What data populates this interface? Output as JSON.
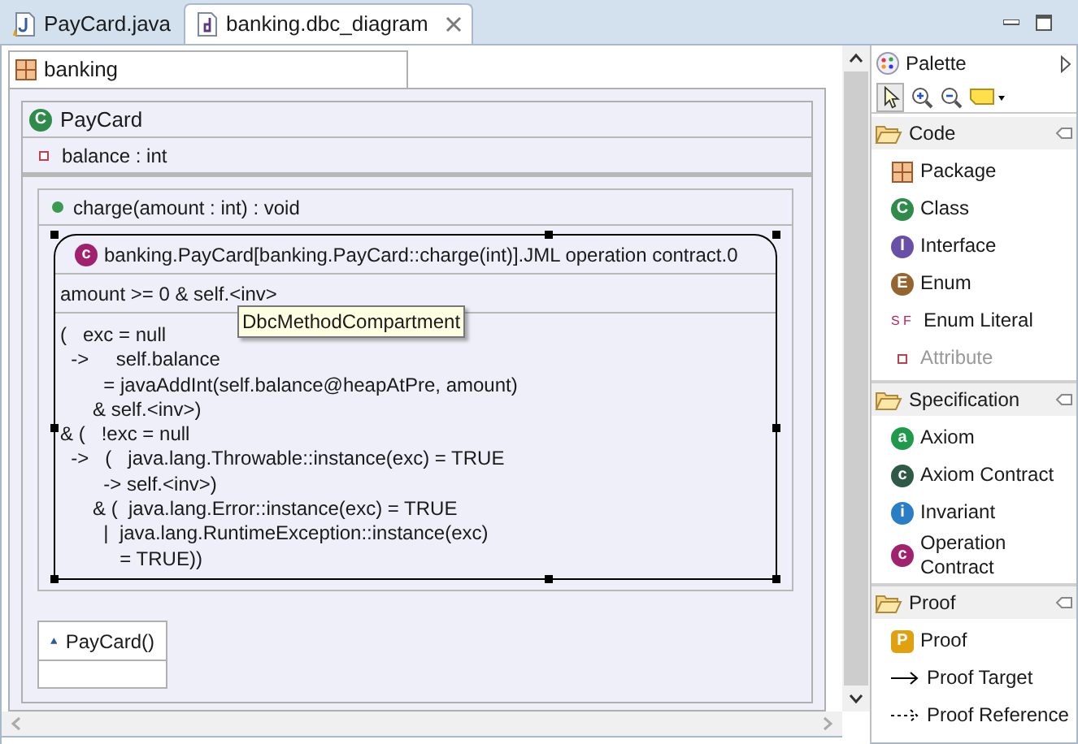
{
  "tabs": [
    {
      "label": "PayCard.java",
      "selected": false,
      "kind": "java"
    },
    {
      "label": "banking.dbc_diagram",
      "selected": true,
      "kind": "diagram"
    }
  ],
  "diagram": {
    "package": {
      "name": "banking"
    },
    "class": {
      "badge": "C",
      "name": "PayCard",
      "attributes": [
        "balance : int"
      ],
      "operation": {
        "signature": "charge(amount : int) : void",
        "selected": true,
        "contract": {
          "badge": "c",
          "title": "banking.PayCard[banking.PayCard::charge(int)].JML operation contract.0",
          "precondition": "amount >= 0 & self.<inv>",
          "postcondition": [
            "(   exc = null",
            "  ->     self.balance",
            "        = javaAddInt(self.balance@heapAtPre, amount)",
            "      & self.<inv>)",
            "& (   !exc = null",
            "  ->   (   java.lang.Throwable::instance(exc) = TRUE",
            "        -> self.<inv>)",
            "      & (  java.lang.Error::instance(exc) = TRUE",
            "        |  java.lang.RuntimeException::instance(exc)",
            "           = TRUE))"
          ]
        }
      },
      "constructor": "PayCard()"
    },
    "tooltip": "DbcMethodCompartment"
  },
  "palette": {
    "title": "Palette",
    "groups": [
      {
        "label": "Code",
        "expanded": true,
        "items": [
          {
            "label": "Package",
            "kind": "package",
            "disabled": false
          },
          {
            "label": "Class",
            "kind": "badge",
            "badge": "C",
            "color": "#2e8b4a",
            "disabled": false
          },
          {
            "label": "Interface",
            "kind": "badge",
            "badge": "I",
            "color": "#6a4fa8",
            "disabled": false
          },
          {
            "label": "Enum",
            "kind": "badge",
            "badge": "E",
            "color": "#94652f",
            "disabled": false
          },
          {
            "label": "Enum Literal",
            "kind": "literal",
            "badge": "S F",
            "disabled": false
          },
          {
            "label": "Attribute",
            "kind": "attribute",
            "disabled": true
          }
        ]
      },
      {
        "label": "Specification",
        "expanded": true,
        "items": [
          {
            "label": "Axiom",
            "kind": "badge",
            "badge": "a",
            "color": "#1f9a4a",
            "disabled": false
          },
          {
            "label": "Axiom Contract",
            "kind": "badge",
            "badge": "c",
            "color": "#2f5a46",
            "disabled": false
          },
          {
            "label": "Invariant",
            "kind": "badge",
            "badge": "i",
            "color": "#2a7fc4",
            "disabled": false
          },
          {
            "label": "Operation Contract",
            "kind": "badge",
            "badge": "c",
            "color": "#a0226e",
            "disabled": false
          }
        ]
      },
      {
        "label": "Proof",
        "expanded": true,
        "items": [
          {
            "label": "Proof",
            "kind": "hex",
            "badge": "P",
            "color": "#e0a010",
            "disabled": false
          },
          {
            "label": "Proof Target",
            "kind": "arrow",
            "disabled": false
          },
          {
            "label": "Proof Reference",
            "kind": "dashed-arrow",
            "disabled": false
          }
        ]
      }
    ]
  }
}
